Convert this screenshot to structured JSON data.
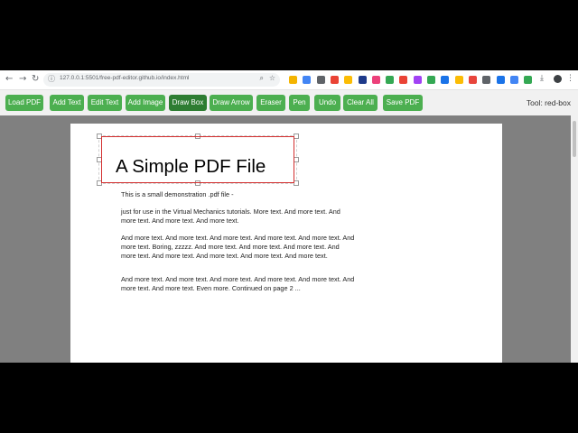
{
  "browser": {
    "url": "127.0.0.1:5501/free-pdf-editor.github.io/index.html",
    "extension_colors": [
      "#f4b400",
      "#4285f4",
      "#5f6368",
      "#ea4335",
      "#fbbc04",
      "#1e3a8a",
      "#ec407a",
      "#34a853",
      "#ea4335",
      "#a142f4",
      "#34a853",
      "#1a73e8",
      "#fbbc04",
      "#e8453c",
      "#5f6368",
      "#1a73e8",
      "#4285f4",
      "#34a853"
    ]
  },
  "toolbar": {
    "buttons": [
      {
        "label": "Load PDF"
      },
      {
        "label": "Add Text"
      },
      {
        "label": "Edit Text"
      },
      {
        "label": "Add Image"
      },
      {
        "label": "Draw Box"
      },
      {
        "label": "Draw Arrow"
      },
      {
        "label": "Eraser"
      },
      {
        "label": "Pen"
      },
      {
        "label": "Undo"
      },
      {
        "label": "Clear All"
      },
      {
        "label": "Save PDF"
      }
    ],
    "active_tool": "Draw Box",
    "tool_status": "Tool: red-box"
  },
  "document": {
    "title": "A Simple PDF File",
    "paragraphs": [
      "This is a small demonstration .pdf file -",
      "just for use in the Virtual Mechanics tutorials. More text. And more text. And more text. And more text. And more text.",
      "And more text. And more text. And more text. And more text. And more text. And more text. Boring, zzzzz. And more text. And more text. And more text. And more text. And more text. And more text. And more text. And more text.",
      "And more text. And more text. And more text. And more text. And more text. And more text. And more text. Even more. Continued on page 2 ..."
    ],
    "annotation_color": "#d32f2f"
  }
}
